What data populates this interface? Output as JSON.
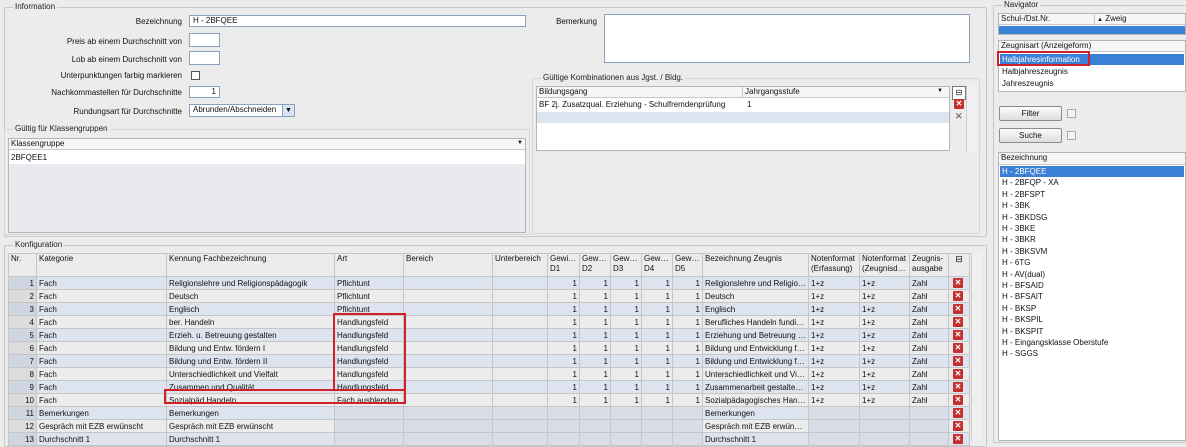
{
  "info": {
    "legend": "Information",
    "bezeichnung_label": "Bezeichnung",
    "bezeichnung_value": "H - 2BFQEE",
    "preis_label": "Preis ab einem Durchschnitt von",
    "lob_label": "Lob ab einem Durchschnitt von",
    "unterpunkt_label": "Unterpunktungen farbig markieren",
    "nachkomma_label": "Nachkommastellen für Durchschnitte",
    "nachkomma_value": "1",
    "rundung_label": "Rundungsart für Durchschnitte",
    "rundung_value": "Abrunden/Abschneiden",
    "bemerkung_label": "Bemerkung"
  },
  "kombi": {
    "legend": "Gültige Kombinationen aus Jgst. / Bldg.",
    "col1": "Bildungsgang",
    "col2": "Jahrgangsstufe",
    "row1_bg": "BF 2j. Zusatzqual. Erziehung - Schulfremdenprüfung",
    "row1_jg": "1"
  },
  "klassen": {
    "legend": "Gültig für Klassengruppen",
    "header": "Klassengruppe",
    "item": "2BFQEE1"
  },
  "konfig": {
    "legend": "Konfiguration",
    "headers": {
      "nr": "Nr.",
      "kategorie": "Kategorie",
      "kennung": "Kennung Fachbezeichnung",
      "art": "Art",
      "bereich": "Bereich",
      "unterbereich": "Unterbereich",
      "g1": "Gewicht D1",
      "g2": "Gewicht D2",
      "g3": "Gewicht D3",
      "g4": "Gewicht D4",
      "g5": "Gewicht D5",
      "bez": "Bezeichnung Zeugnis",
      "nf1": "Notenformat (Erfassung)",
      "nf2": "Notenformat (Zeugnisdruck)",
      "zeug": "Zeugnis-ausgabe"
    },
    "rows": [
      {
        "nr": "1",
        "kat": "Fach",
        "ken": "Religionslehre und Religionspädagogik",
        "art": "Pflichtunt",
        "g": [
          "1",
          "1",
          "1",
          "1",
          "1"
        ],
        "bez": "Religionslehre und Religions…",
        "nf1": "1+z",
        "nf2": "1+z",
        "z": "Zahl"
      },
      {
        "nr": "2",
        "kat": "Fach",
        "ken": "Deutsch",
        "art": "Pflichtunt",
        "g": [
          "1",
          "1",
          "1",
          "1",
          "1"
        ],
        "bez": "Deutsch",
        "nf1": "1+z",
        "nf2": "1+z",
        "z": "Zahl"
      },
      {
        "nr": "3",
        "kat": "Fach",
        "ken": "Englisch",
        "art": "Pflichtunt",
        "g": [
          "1",
          "1",
          "1",
          "1",
          "1"
        ],
        "bez": "Englisch",
        "nf1": "1+z",
        "nf2": "1+z",
        "z": "Zahl"
      },
      {
        "nr": "4",
        "kat": "Fach",
        "ken": "ber. Handeln",
        "art": "Handlungsfeld",
        "g": [
          "1",
          "1",
          "1",
          "1",
          "1"
        ],
        "bez": "Berufliches Handeln fundier…",
        "nf1": "1+z",
        "nf2": "1+z",
        "z": "Zahl"
      },
      {
        "nr": "5",
        "kat": "Fach",
        "ken": "Erzieh. u. Betreuung gestalten",
        "art": "Handlungsfeld",
        "g": [
          "1",
          "1",
          "1",
          "1",
          "1"
        ],
        "bez": "Erziehung und Betreuung ge…",
        "nf1": "1+z",
        "nf2": "1+z",
        "z": "Zahl"
      },
      {
        "nr": "6",
        "kat": "Fach",
        "ken": "Bildung und Entw. fördern I",
        "art": "Handlungsfeld",
        "g": [
          "1",
          "1",
          "1",
          "1",
          "1"
        ],
        "bez": "Bildung und Entwicklung för…",
        "nf1": "1+z",
        "nf2": "1+z",
        "z": "Zahl"
      },
      {
        "nr": "7",
        "kat": "Fach",
        "ken": "Bildung und Entw. fördern II",
        "art": "Handlungsfeld",
        "g": [
          "1",
          "1",
          "1",
          "1",
          "1"
        ],
        "bez": "Bildung und Entwicklung för…",
        "nf1": "1+z",
        "nf2": "1+z",
        "z": "Zahl"
      },
      {
        "nr": "8",
        "kat": "Fach",
        "ken": "Unterschiedlichkeit und Vielfalt",
        "art": "Handlungsfeld",
        "g": [
          "1",
          "1",
          "1",
          "1",
          "1"
        ],
        "bez": "Unterschiedlichkeit und Viel…",
        "nf1": "1+z",
        "nf2": "1+z",
        "z": "Zahl"
      },
      {
        "nr": "9",
        "kat": "Fach",
        "ken": "Zusammen und Qualität",
        "art": "Handlungsfeld",
        "g": [
          "1",
          "1",
          "1",
          "1",
          "1"
        ],
        "bez": "Zusammenarbeit gestalten …",
        "nf1": "1+z",
        "nf2": "1+z",
        "z": "Zahl"
      },
      {
        "nr": "10",
        "kat": "Fach",
        "ken": "Sozialpäd.Handeln",
        "art": "Fach ausblenden",
        "g": [
          "1",
          "1",
          "1",
          "1",
          "1"
        ],
        "bez": "Sozialpädagogisches Handeln",
        "nf1": "1+z",
        "nf2": "1+z",
        "z": "Zahl"
      },
      {
        "nr": "11",
        "kat": "Bemerkungen",
        "ken": "Bemerkungen",
        "art": "",
        "g": [
          "",
          "",
          "",
          "",
          ""
        ],
        "bez": "Bemerkungen",
        "nf1": "",
        "nf2": "",
        "z": ""
      },
      {
        "nr": "12",
        "kat": "Gespräch mit EZB erwünscht",
        "ken": "Gespräch mit EZB erwünscht",
        "art": "",
        "g": [
          "",
          "",
          "",
          "",
          ""
        ],
        "bez": "Gespräch mit EZB erwünscht",
        "nf1": "",
        "nf2": "",
        "z": ""
      },
      {
        "nr": "13",
        "kat": "Durchschnitt 1",
        "ken": "Durchschnitt 1",
        "art": "",
        "g": [
          "",
          "",
          "",
          "",
          ""
        ],
        "bez": "Durchschnitt 1",
        "nf1": "",
        "nf2": "",
        "z": ""
      }
    ]
  },
  "nav": {
    "legend": "Navigator",
    "col1": "Schul-/Dst.Nr.",
    "col2": "Zweig",
    "zeugnisart_header": "Zeugnisart (Anzeigeform)",
    "zeugnisart_items": [
      "Halbjahresinformation",
      "Halbjahreszeugnis",
      "Jahreszeugnis"
    ],
    "filter_label": "Filter",
    "suche_label": "Suche",
    "bez_header": "Bezeichnung",
    "bez_items": [
      "H - 2BFQEE",
      "H - 2BFQP - XA",
      "H - 2BFSPT",
      "H - 3BK",
      "H - 3BKDSG",
      "H - 3BKE",
      "H - 3BKR",
      "H - 3BKSVM",
      "H - 6TG",
      "H - AV(dual)",
      "H - BFSAID",
      "H - BFSAIT",
      "H - BKSP",
      "H - BKSPIL",
      "H - BKSPIT",
      "H - Eingangsklasse Oberstufe",
      "H - SGGS"
    ]
  },
  "colors": {
    "selection": "#3c7fd6",
    "highlight": "#d0202a",
    "alt_row": "#dde4f0"
  }
}
